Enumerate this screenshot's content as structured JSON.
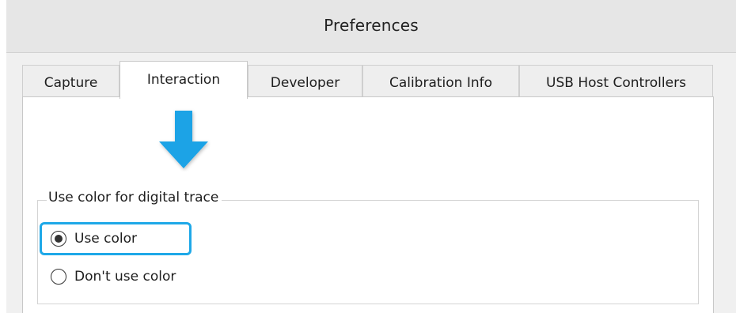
{
  "window": {
    "title": "Preferences"
  },
  "tabs": [
    {
      "label": "Capture",
      "active": false
    },
    {
      "label": "Interaction",
      "active": true
    },
    {
      "label": "Developer",
      "active": false
    },
    {
      "label": "Calibration Info",
      "active": false
    },
    {
      "label": "USB Host Controllers",
      "active": false
    }
  ],
  "group": {
    "legend": "Use color for digital trace",
    "options": [
      {
        "label": "Use color",
        "checked": true
      },
      {
        "label": "Don't use color",
        "checked": false
      }
    ]
  },
  "annotation": {
    "arrow_color": "#1aa3e6",
    "highlight_color": "#1ea8e8",
    "arrow_icon": "down-arrow-icon"
  }
}
